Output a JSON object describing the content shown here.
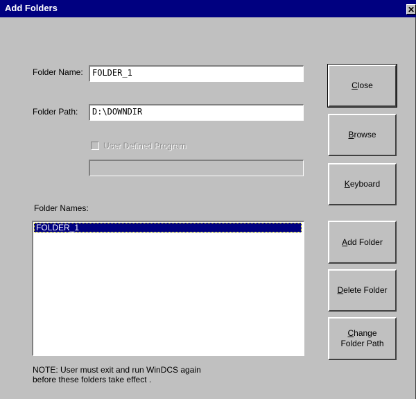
{
  "window": {
    "title": "Add Folders",
    "close_glyph": "✕"
  },
  "form": {
    "folder_name_label": "Folder Name:",
    "folder_name_value": "FOLDER_1",
    "folder_path_label": "Folder Path:",
    "folder_path_value": "D:\\DOWNDIR",
    "user_defined_program_label": "User Defined Program",
    "user_defined_program_checked": false,
    "user_defined_program_value": ""
  },
  "list": {
    "label": "Folder Names:",
    "items": [
      "FOLDER_1"
    ],
    "selected_index": 0
  },
  "buttons": {
    "close": {
      "accel": "C",
      "rest": "lose"
    },
    "browse": {
      "accel": "B",
      "rest": "rowse"
    },
    "keyboard": {
      "accel": "K",
      "rest": "eyboard"
    },
    "add_folder": {
      "accel": "A",
      "rest": "dd Folder"
    },
    "delete_folder": {
      "accel": "D",
      "rest": "elete Folder"
    },
    "change_path": {
      "accel": "C",
      "rest": "hange",
      "line2": "Folder Path"
    }
  },
  "note": {
    "line1": "NOTE: User must exit and run WinDCS again",
    "line2": "before these folders take effect ."
  }
}
